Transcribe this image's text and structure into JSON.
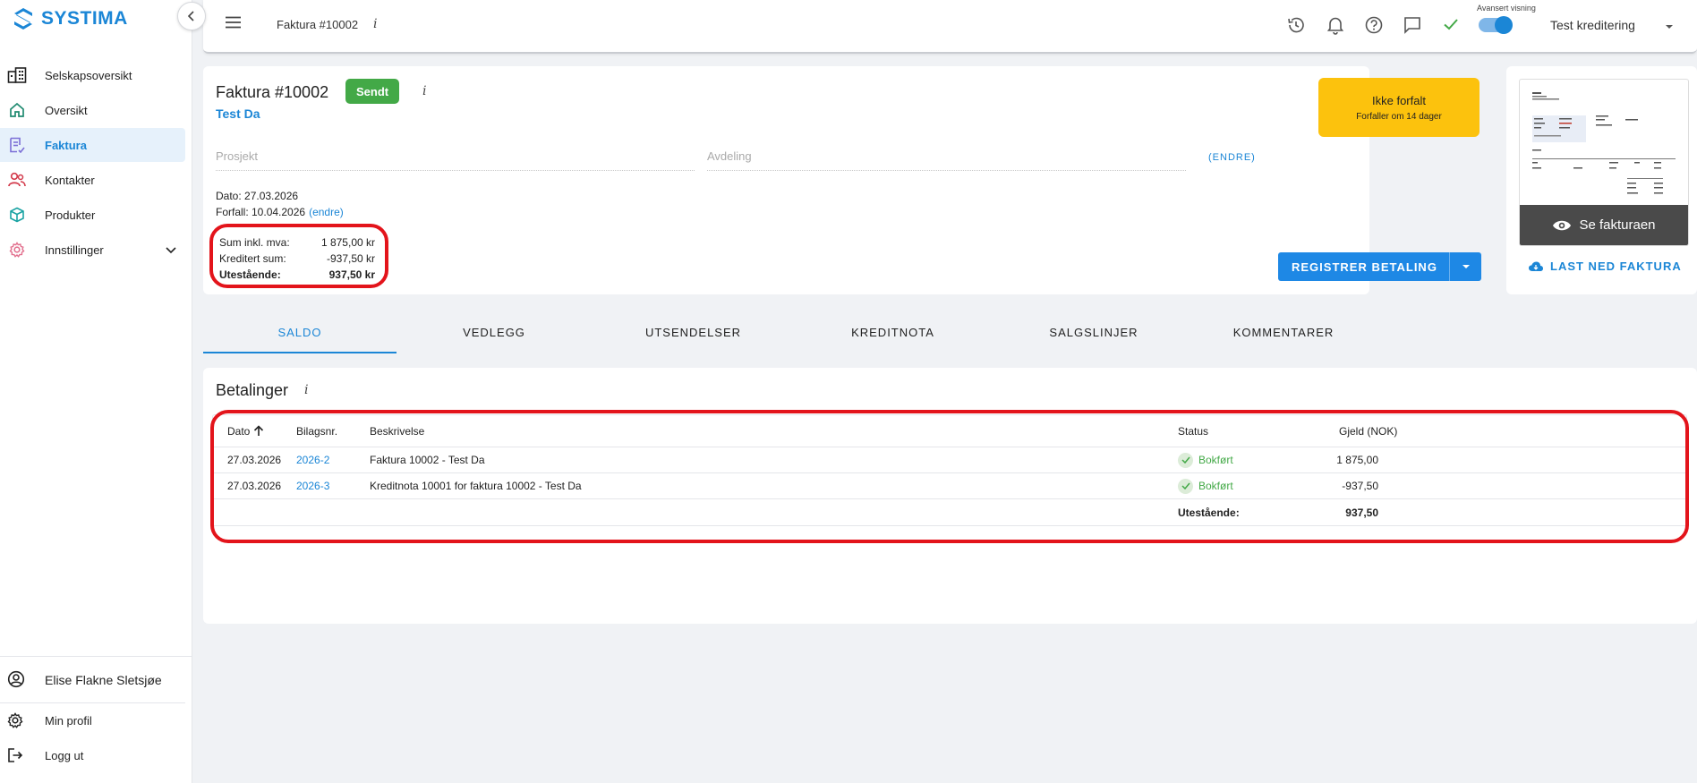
{
  "app": {
    "logo_text": "SYSTIMA"
  },
  "sidebar": {
    "items": [
      {
        "label": "Selskapsoversikt",
        "icon": "company-overview-icon"
      },
      {
        "label": "Oversikt",
        "icon": "home-icon"
      },
      {
        "label": "Faktura",
        "icon": "invoice-icon",
        "active": true
      },
      {
        "label": "Kontakter",
        "icon": "contacts-icon"
      },
      {
        "label": "Produkter",
        "icon": "box-icon"
      },
      {
        "label": "Innstillinger",
        "icon": "gear-icon"
      }
    ],
    "user_name": "Elise Flakne Sletsjøe",
    "profile_label": "Min profil",
    "logout_label": "Logg ut"
  },
  "topbar": {
    "breadcrumb": "Faktura #10002",
    "info_glyph": "i",
    "advanced_view_label": "Avansert visning",
    "advanced_view_on": true,
    "company": "Test kreditering"
  },
  "invoice": {
    "title": "Faktura #10002",
    "status_badge": "Sendt",
    "info_glyph": "i",
    "customer": "Test Da",
    "project_placeholder": "Prosjekt",
    "department_placeholder": "Avdeling",
    "endre_caps": "(ENDRE)",
    "date_line": "Dato: 27.03.2026",
    "due_line": "Forfall: 10.04.2026",
    "due_edit": "(endre)",
    "sum_label": "Sum inkl. mva:",
    "sum_value": "1 875,00 kr",
    "credited_label": "Kreditert sum:",
    "credited_value": "-937,50 kr",
    "outstanding_label": "Utestående:",
    "outstanding_value": "937,50 kr",
    "due_status": "Ikke forfalt",
    "due_status_sub": "Forfaller om 14 dager",
    "register_payment": "REGISTRER BETALING"
  },
  "preview": {
    "view_label": "Se fakturaen",
    "download_label": "LAST NED FAKTURA"
  },
  "tabs": [
    {
      "label": "SALDO",
      "active": true
    },
    {
      "label": "VEDLEGG"
    },
    {
      "label": "UTSENDELSER"
    },
    {
      "label": "KREDITNOTA"
    },
    {
      "label": "SALGSLINJER"
    },
    {
      "label": "KOMMENTARER"
    }
  ],
  "payments": {
    "title": "Betalinger",
    "info_glyph": "i",
    "columns": [
      "Dato",
      "Bilagsnr.",
      "Beskrivelse",
      "Status",
      "Gjeld (NOK)"
    ],
    "rows": [
      {
        "date": "27.03.2026",
        "voucher": "2026-2",
        "description": "Faktura 10002 - Test Da",
        "status": "Bokført",
        "amount": "1 875,00"
      },
      {
        "date": "27.03.2026",
        "voucher": "2026-3",
        "description": "Kreditnota 10001 for faktura 10002 - Test Da",
        "status": "Bokført",
        "amount": "-937,50"
      }
    ],
    "footer_label": "Utestående:",
    "footer_value": "937,50"
  },
  "colors": {
    "brand": "#1b86d6",
    "success": "#43a947",
    "warning": "#fcc20d",
    "highlight": "#e3141b"
  }
}
